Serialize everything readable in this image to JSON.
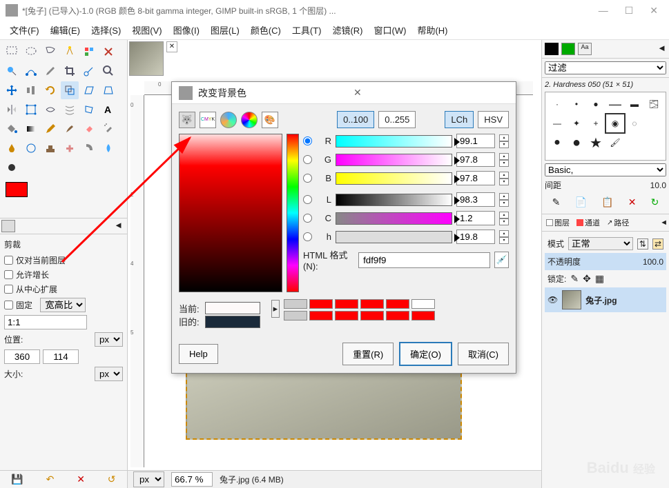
{
  "window": {
    "title": "*[兔子] (已导入)-1.0 (RGB 颜色 8-bit gamma integer, GIMP built-in sRGB, 1 个图层) ...",
    "min": "—",
    "max": "☐",
    "close": "✕"
  },
  "menu": {
    "file": "文件(F)",
    "edit": "编辑(E)",
    "select": "选择(S)",
    "view": "视图(V)",
    "image": "图像(I)",
    "layer": "图层(L)",
    "color": "颜色(C)",
    "tools": "工具(T)",
    "filter": "滤镜(R)",
    "window": "窗口(W)",
    "help": "帮助(H)"
  },
  "toolbox": {
    "fg_color": "#ff0000",
    "bg_color": "#ffffff"
  },
  "tool_options": {
    "title": "剪裁",
    "current_layer_only": "仅对当前图层",
    "allow_grow": "允许增长",
    "expand_from_center": "从中心扩展",
    "fixed": "固定",
    "aspect": "宽高比",
    "ratio": "1:1",
    "position": "位置:",
    "pos_x": "360",
    "pos_y": "114",
    "pos_unit": "px",
    "size": "大小:",
    "size_unit": "px"
  },
  "status": {
    "unit": "px",
    "zoom": "66.7 %",
    "file_info": "兔子.jpg (6.4 MB)"
  },
  "right": {
    "filter_label": "过滤",
    "brush_name": "2. Hardness 050 (51 × 51)",
    "basic": "Basic,",
    "spacing": "间距",
    "spacing_val": "10.0",
    "tabs": {
      "layers": "图层",
      "channels": "通道",
      "paths": "路径"
    },
    "mode": "模式",
    "mode_val": "正常",
    "opacity": "不透明度",
    "opacity_val": "100.0",
    "lock": "锁定:",
    "layer_name": "兔子.jpg"
  },
  "dialog": {
    "title": "改变背景色",
    "range_100": "0..100",
    "range_255": "0..255",
    "lch": "LCh",
    "hsv": "HSV",
    "channels": {
      "R": {
        "label": "R",
        "val": "99.1"
      },
      "G": {
        "label": "G",
        "val": "97.8"
      },
      "B": {
        "label": "B",
        "val": "97.8"
      },
      "L": {
        "label": "L",
        "val": "98.3"
      },
      "C": {
        "label": "C",
        "val": "1.2"
      },
      "h": {
        "label": "h",
        "val": "19.8"
      }
    },
    "html_label": "HTML 格式(N):",
    "html_val": "fdf9f9",
    "current": "当前:",
    "old": "旧的:",
    "old_color": "#1a2a3a",
    "current_color": "#fdf9f9",
    "help": "Help",
    "reset": "重置(R)",
    "ok": "确定(O)",
    "cancel": "取消(C)"
  },
  "watermark": {
    "brand": "Baidu",
    "sub": "经验"
  }
}
